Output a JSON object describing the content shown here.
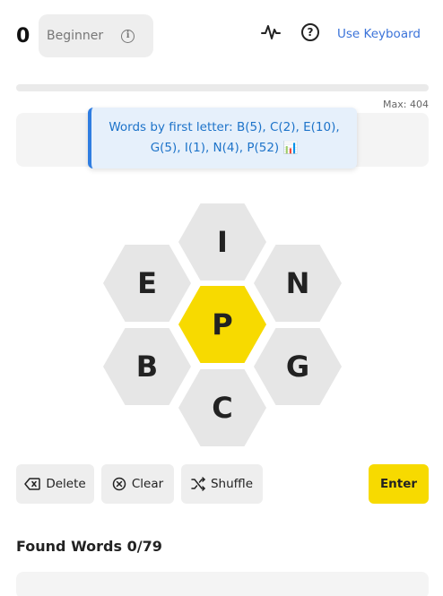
{
  "header": {
    "score": "0",
    "rank": "Beginner",
    "info_icon": "info-icon",
    "activity_icon": "activity-icon",
    "help_icon": "help-icon",
    "use_keyboard": "Use Keyboard"
  },
  "progress": {
    "fraction": 0,
    "max_label": "Max: 404"
  },
  "tooltip": {
    "text": "Words by first letter: B(5), C(2), E(10), G(5), I(1), N(4), P(52) 📊"
  },
  "hive": {
    "center": "P",
    "top": "I",
    "upper_left": "E",
    "upper_right": "N",
    "lower_left": "B",
    "lower_right": "G",
    "bottom": "C",
    "center_color": "#f7da00",
    "outer_color": "#e6e6e6"
  },
  "controls": {
    "delete": "Delete",
    "delete_icon": "backspace-icon",
    "clear": "Clear",
    "clear_icon": "clear-circle-icon",
    "shuffle": "Shuffle",
    "shuffle_icon": "shuffle-icon",
    "enter": "Enter"
  },
  "found": {
    "title": "Found Words 0/79"
  },
  "colors": {
    "accent_yellow": "#f7da00",
    "link_blue": "#3b73d9",
    "tooltip_blue": "#1d73c9"
  }
}
